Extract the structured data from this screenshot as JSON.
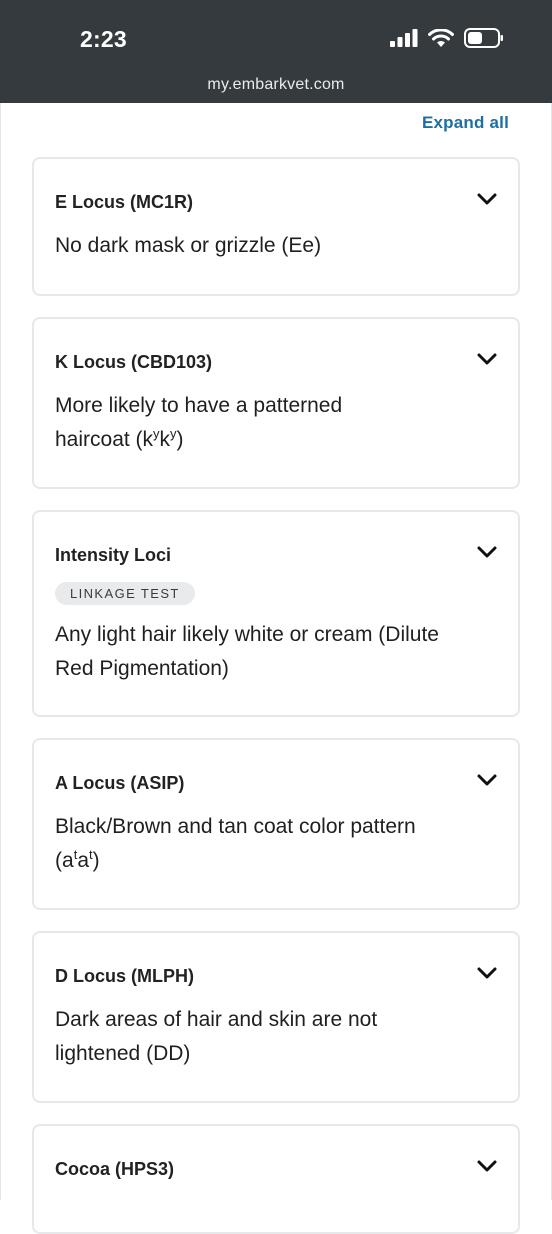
{
  "status_bar": {
    "time": "2:23"
  },
  "browser": {
    "url": "my.embarkvet.com"
  },
  "expand_all_label": "Expand all",
  "traits": [
    {
      "title": "E Locus (MC1R)",
      "description": "No dark mask or grizzle (Ee)"
    },
    {
      "title": "K Locus (CBD103)",
      "description_pre": "More likely to have a patterned haircoat (k",
      "sup1": "y",
      "mid": "k",
      "sup2": "y",
      "post": ")"
    },
    {
      "title": "Intensity Loci",
      "badge": "LINKAGE TEST",
      "description": "Any light hair likely white or cream (Dilute Red Pigmentation)"
    },
    {
      "title": "A Locus (ASIP)",
      "description_pre": "Black/Brown and tan coat color pattern (a",
      "sup1": "t",
      "mid": "a",
      "sup2": "t",
      "post": ")"
    },
    {
      "title": "D Locus (MLPH)",
      "description": "Dark areas of hair and skin are not lightened (DD)"
    },
    {
      "title": "Cocoa (HPS3)"
    }
  ]
}
